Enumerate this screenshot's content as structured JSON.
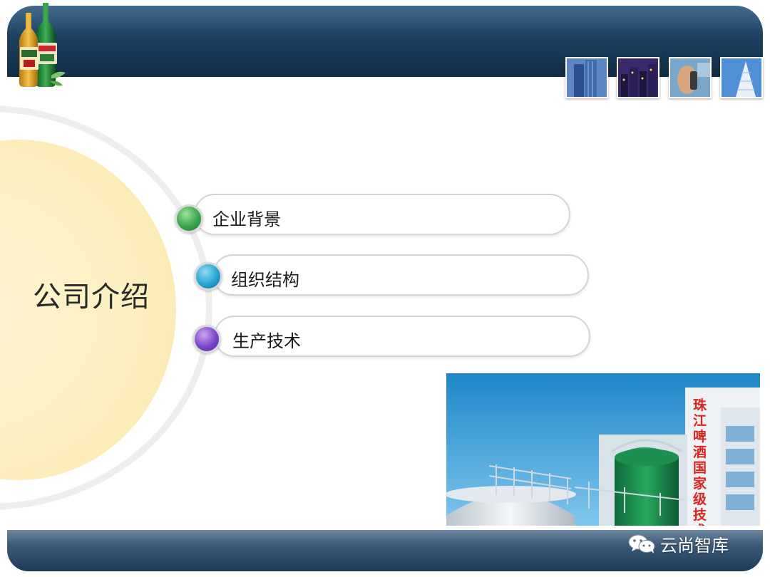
{
  "slide": {
    "section_title": "公司介绍",
    "menu": [
      {
        "label": "企业背景",
        "bullet_color": "#3aa54a"
      },
      {
        "label": "组织结构",
        "bullet_color": "#27a3d3"
      },
      {
        "label": "生产技术",
        "bullet_color": "#7b45c9"
      }
    ],
    "factory_sign": "珠江啤酒国家级技术中",
    "watermark": "云尚智库",
    "icons": [
      "beer-bottles-logo",
      "wechat-icon"
    ],
    "colors": {
      "header": "#1d4060",
      "footer": "#3d5a78",
      "sun": "#fdf0c2",
      "arc": "#eeeeee"
    }
  }
}
